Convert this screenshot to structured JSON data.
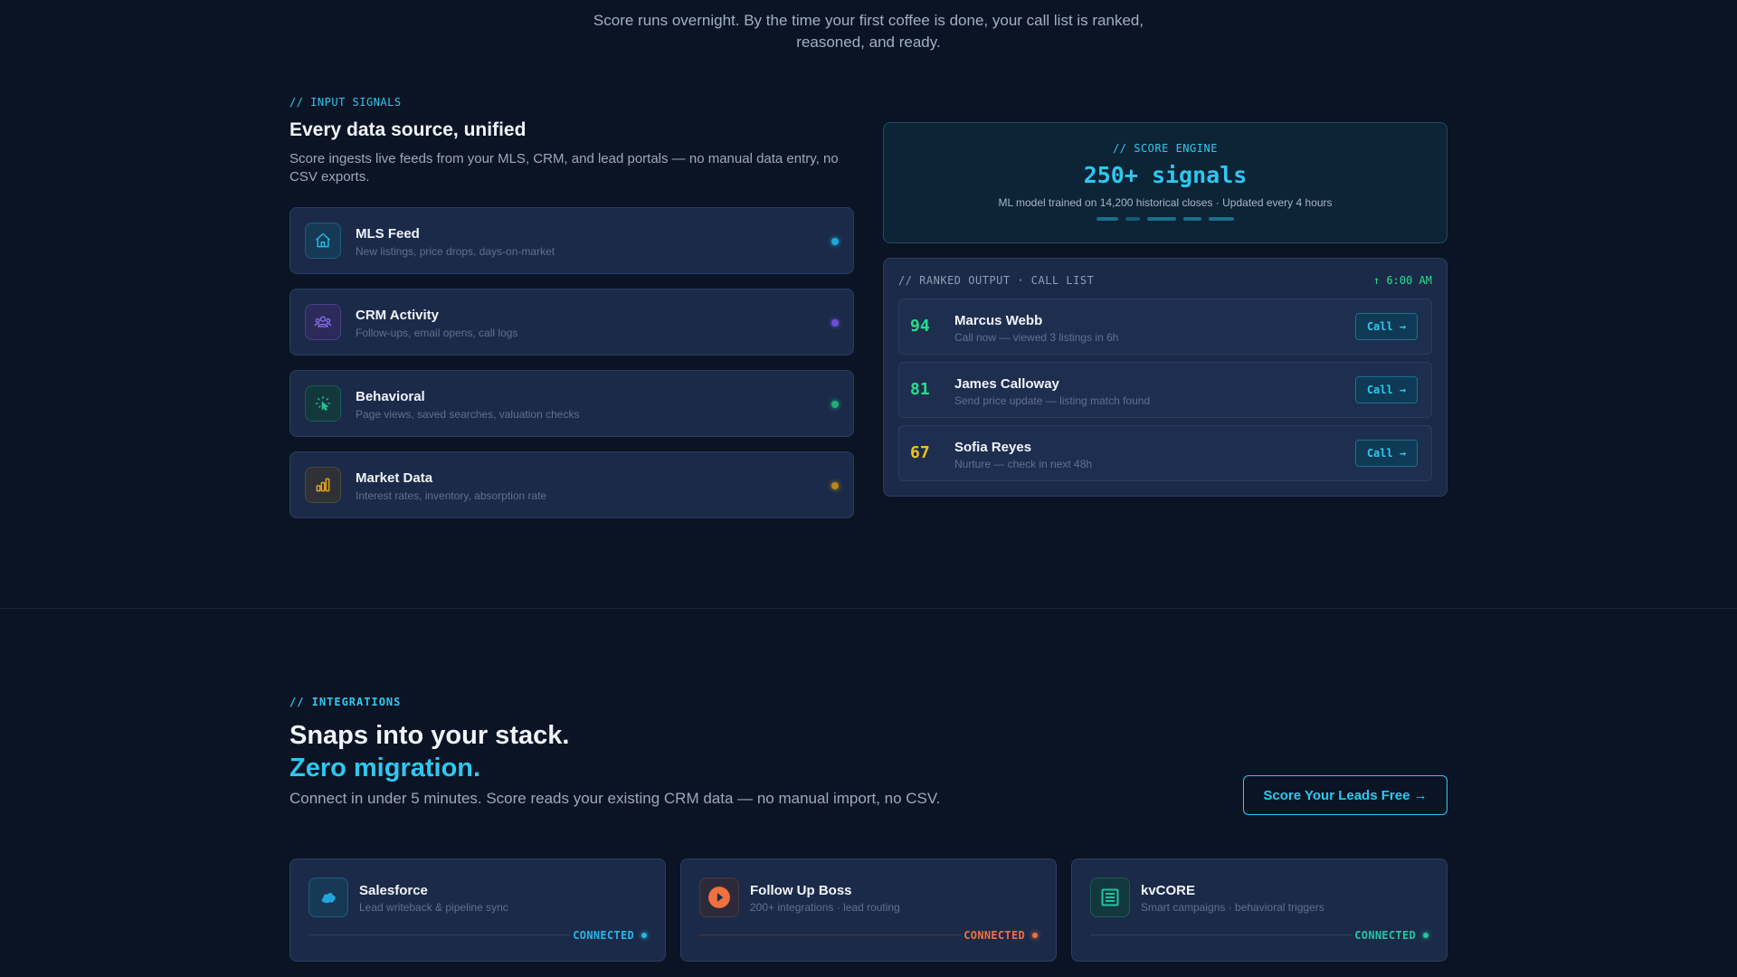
{
  "intro": {
    "line1": "Score runs overnight. By the time your first coffee is done, your call list is ranked,",
    "line2": "reasoned, and ready."
  },
  "signals": {
    "eyebrow": "// INPUT SIGNALS",
    "title": "Every data source, unified",
    "desc": "Score ingests live feeds from your MLS, CRM, and lead portals — no manual data entry, no CSV exports.",
    "sources": [
      {
        "title": "MLS Feed",
        "sub": "New listings, price drops, days-on-market",
        "icon": "home-icon",
        "color": "#22b8e6"
      },
      {
        "title": "CRM Activity",
        "sub": "Follow-ups, email opens, call logs",
        "icon": "users-icon",
        "color": "#8b6cf0"
      },
      {
        "title": "Behavioral",
        "sub": "Page views, saved searches, valuation checks",
        "icon": "pointer-click-icon",
        "color": "#22c48a"
      },
      {
        "title": "Market Data",
        "sub": "Interest rates, inventory, absorption rate",
        "icon": "bar-chart-icon",
        "color": "#e0a21c"
      }
    ]
  },
  "engine": {
    "eyebrow": "// SCORE ENGINE",
    "headline": "250+ signals",
    "sub": "ML model trained on 14,200 historical closes · Updated every 4 hours"
  },
  "ranked": {
    "label": "// RANKED OUTPUT · CALL LIST",
    "time": "↑ 6:00 AM",
    "leads": [
      {
        "score": "94",
        "name": "Marcus Webb",
        "note": "Call now — viewed 3 listings in 6h",
        "color": "#22e08a",
        "action": "Call →"
      },
      {
        "score": "81",
        "name": "James Calloway",
        "note": "Send price update — listing match found",
        "color": "#22e08a",
        "action": "Call →"
      },
      {
        "score": "67",
        "name": "Sofia Reyes",
        "note": "Nurture — check in next 48h",
        "color": "#f2c21b",
        "action": "Call →"
      }
    ]
  },
  "integrations": {
    "eyebrow": "// INTEGRATIONS",
    "title": "Snaps into your stack.",
    "title_accent": "Zero migration.",
    "desc": "Connect in under 5 minutes. Score reads your existing CRM data — no manual import, no CSV.",
    "cta": "Score Your Leads Free →",
    "cards": [
      {
        "title": "Salesforce",
        "sub": "Lead writeback & pipeline sync",
        "status": "CONNECTED",
        "color": "#22b8e6",
        "icon": "cloud-icon"
      },
      {
        "title": "Follow Up Boss",
        "sub": "200+ integrations · lead routing",
        "status": "CONNECTED",
        "color": "#f07040",
        "icon": "play-icon"
      },
      {
        "title": "kvCORE",
        "sub": "Smart campaigns · behavioral triggers",
        "status": "CONNECTED",
        "color": "#22c4a0",
        "icon": "document-icon"
      }
    ]
  }
}
